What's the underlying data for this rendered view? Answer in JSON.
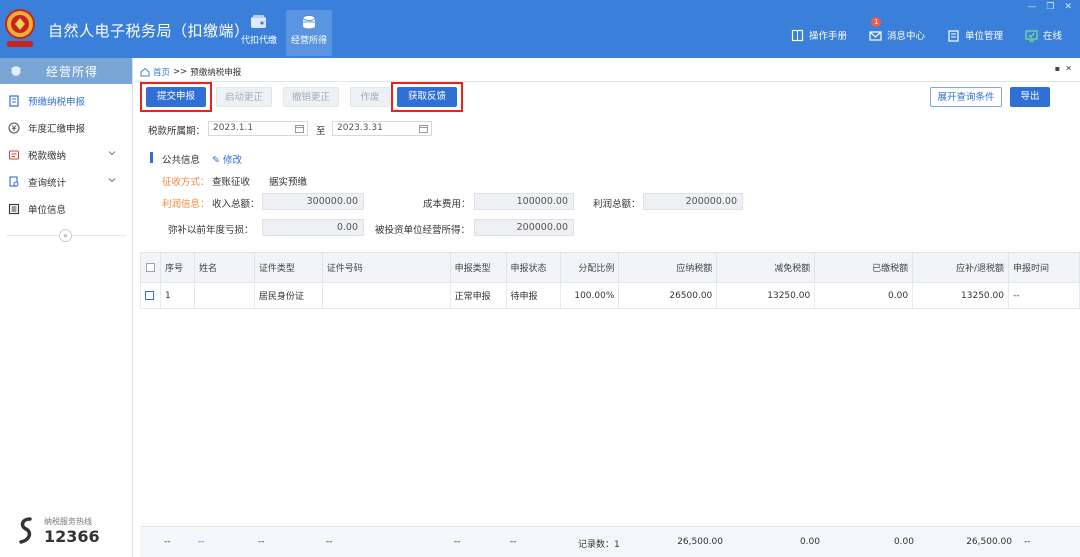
{
  "app": {
    "title": "自然人电子税务局（扣缴端）",
    "nav_tabs": [
      {
        "label": "代扣代缴",
        "icon": "wallet-icon"
      },
      {
        "label": "经营所得",
        "icon": "coins-icon"
      }
    ],
    "header_links": [
      {
        "label": "操作手册",
        "icon": "book-icon"
      },
      {
        "label": "消息中心",
        "icon": "mail-icon",
        "badge": "1"
      },
      {
        "label": "单位管理",
        "icon": "building-icon"
      },
      {
        "label": "在线",
        "icon": "monitor-icon"
      }
    ]
  },
  "sidebar": {
    "title": "经营所得",
    "items": [
      {
        "label": "预缴纳税申报",
        "icon": "tax-doc-icon"
      },
      {
        "label": "年度汇缴申报",
        "icon": "yen-circle-icon"
      },
      {
        "label": "税款缴纳",
        "icon": "invoice-icon"
      },
      {
        "label": "查询统计",
        "icon": "search-doc-icon"
      },
      {
        "label": "单位信息",
        "icon": "list-icon"
      }
    ],
    "collapse": "«",
    "hotline_label": "纳税服务热线",
    "hotline_number": "12366"
  },
  "breadcrumb": {
    "home": "首页",
    "sep": ">>",
    "current": "预缴纳税申报"
  },
  "toolbar": {
    "submit": "提交申报",
    "start_correct": "启动更正",
    "cancel_correct": "撤销更正",
    "void": "作废",
    "get_feedback": "获取反馈",
    "expand_query": "展开查询条件",
    "export": "导出"
  },
  "period": {
    "label": "税款所属期：",
    "start": "2023.1.1",
    "to": "至",
    "end": "2023.3.31"
  },
  "public_info": {
    "title": "公共信息",
    "edit": "修改",
    "collect_label": "征收方式：",
    "collect_value": "查账征收",
    "collect_extra": "据实预缴",
    "profit_label": "利润信息：",
    "income_label": "收入总额：",
    "income_value": "300000.00",
    "cost_label": "成本费用：",
    "cost_value": "100000.00",
    "profit_total_label": "利润总额：",
    "profit_total_value": "200000.00",
    "loss_label": "弥补以前年度亏损：",
    "loss_value": "0.00",
    "invest_label": "被投资单位经营所得：",
    "invest_value": "200000.00"
  },
  "table": {
    "headers": [
      "序号",
      "姓名",
      "证件类型",
      "证件号码",
      "申报类型",
      "申报状态",
      "分配比例",
      "应纳税额",
      "减免税额",
      "已缴税额",
      "应补/退税额",
      "申报时间"
    ],
    "rows": [
      [
        "1",
        "",
        "居民身份证",
        "",
        "正常申报",
        "待申报",
        "100.00%",
        "26500.00",
        "13250.00",
        "0.00",
        "13250.00",
        "--"
      ]
    ],
    "footer": {
      "c1": "--",
      "c2": "--",
      "c3": "--",
      "c4": "--",
      "c5": "--",
      "c6": "--",
      "records": "记录数：1",
      "tax": "26,500.00",
      "reduce": "0.00",
      "paid": "0.00",
      "refund": "26,500.00",
      "time": "--"
    }
  },
  "colors": {
    "header_bg": "#3a7fd9",
    "primary": "#2f6fd6",
    "highlight": "#e8231c",
    "orange_label": "#f0883a"
  }
}
